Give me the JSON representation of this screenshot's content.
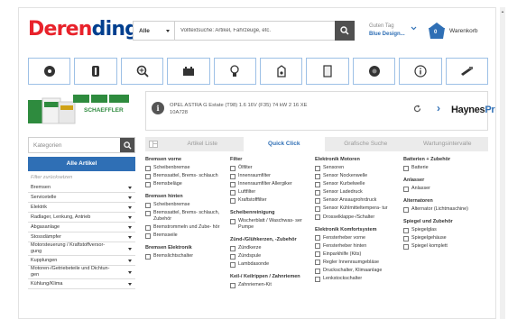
{
  "header": {
    "logo_part1": "Deren",
    "logo_part2": "dinger",
    "search_scope": "Alle",
    "search_placeholder": "Volltextsuche: Artikel, Fahrzeuge, etc.",
    "greeting": "Guten Tag",
    "user_name": "Blue Design...",
    "cart_label": "Warenkorb",
    "cart_count": "0"
  },
  "category_icons": [
    "brake-disc-icon",
    "shock-absorber-icon",
    "search-parts-icon",
    "battery-icon",
    "bulb-icon",
    "oil-can-icon",
    "filter-icon",
    "tire-icon",
    "info-icon",
    "tool-icon"
  ],
  "banner": {
    "brand": "SCHAEFFLER"
  },
  "vehicle": {
    "line1": "OPEL ASTRA G Estate (T98) 1.6 16V (F35) 74 kW 2 16 XE",
    "line2": "10A728",
    "service_logo_part1": "Haynes",
    "service_logo_part2": "Pro"
  },
  "sidebar": {
    "category_placeholder": "Kategorien",
    "all_articles": "Alle Artikel",
    "filter_reset": "Filter zurücksetzen",
    "items": [
      {
        "label": "Bremsen"
      },
      {
        "label": "Servicetelle"
      },
      {
        "label": "Elektrik"
      },
      {
        "label": "Radlager, Lenkung, Antrieb"
      },
      {
        "label": "Abgasanlage"
      },
      {
        "label": "Stossdämpfer"
      },
      {
        "label": "Motorsteuerung / Kraftstoffversor- gung"
      },
      {
        "label": "Kupplungen"
      },
      {
        "label": "Motoren-/Getriebeteile und Dichtun- gen"
      },
      {
        "label": "Kühlung/Klima"
      }
    ]
  },
  "tabs": [
    "Artikel Liste",
    "Quick Click",
    "Grafische Suche",
    "Wartungsintervalle"
  ],
  "columns": [
    {
      "groups": [
        {
          "title": "Bremsen vorne",
          "items": [
            "Scheibenbremse",
            "Bremssattel, Brems- schlauch",
            "Bremsbeläge"
          ]
        },
        {
          "title": "Bremsen hinten",
          "items": [
            "Scheibenbremse",
            "Bremssattel, Brems- schlauch, Zubehör",
            "Bremstrommeln und Zube- hör",
            "Bremsseile"
          ]
        },
        {
          "title": "Bremsen Elektronik",
          "items": [
            "Bremslichtschalter"
          ]
        }
      ]
    },
    {
      "groups": [
        {
          "title": "Filter",
          "items": [
            "Ölfilter",
            "Innenraumfilter",
            "Innenraumfilter Allergiker",
            "Luftfilter",
            "Kraftstofffilter"
          ]
        },
        {
          "title": "Scheibenreinigung",
          "items": [
            "Wischerblatt / Waschwas- ser Pumpe"
          ]
        },
        {
          "title": "Zünd-/Glühkerzen, -Zubehör",
          "items": [
            "Zündkerze",
            "Zündspule",
            "Lambdasonde"
          ]
        },
        {
          "title": "Keil-/ Keilrippen / Zahnriemen",
          "items": [
            "Zahnriemen-Kit"
          ]
        }
      ]
    },
    {
      "groups": [
        {
          "title": "Elektronik Motoren",
          "items": [
            "Sensoren",
            "Sensor Nockenwelle",
            "Sensor Kurbelwelle",
            "Sensor Ladedruck",
            "Sensor Ansaugrohrdruck",
            "Sensor Kühlmitteltempera- tur",
            "Drosselklappe-/Schalter"
          ]
        },
        {
          "title": "Elektronik Komfortsystem",
          "items": [
            "Fensterheber vorne",
            "Fensterheber hinten",
            "Einparkhilfe (Kits)",
            "Regler Innenraumgebläse",
            "Druckschalter, Klimaanlage",
            "Lenkstockschalter"
          ]
        }
      ]
    },
    {
      "groups": [
        {
          "title": "Batterien + Zubehör",
          "items": [
            "Batterie"
          ]
        },
        {
          "title": "Anlasser",
          "items": [
            "Anlasser"
          ]
        },
        {
          "title": "Alternatoren",
          "items": [
            "Alternator (Lichtmaschine)"
          ]
        },
        {
          "title": "Spiegel und Zubehör",
          "items": [
            "Spiegelglas",
            "Spiegelgehäuse",
            "Spiegel komplett"
          ]
        }
      ]
    }
  ]
}
